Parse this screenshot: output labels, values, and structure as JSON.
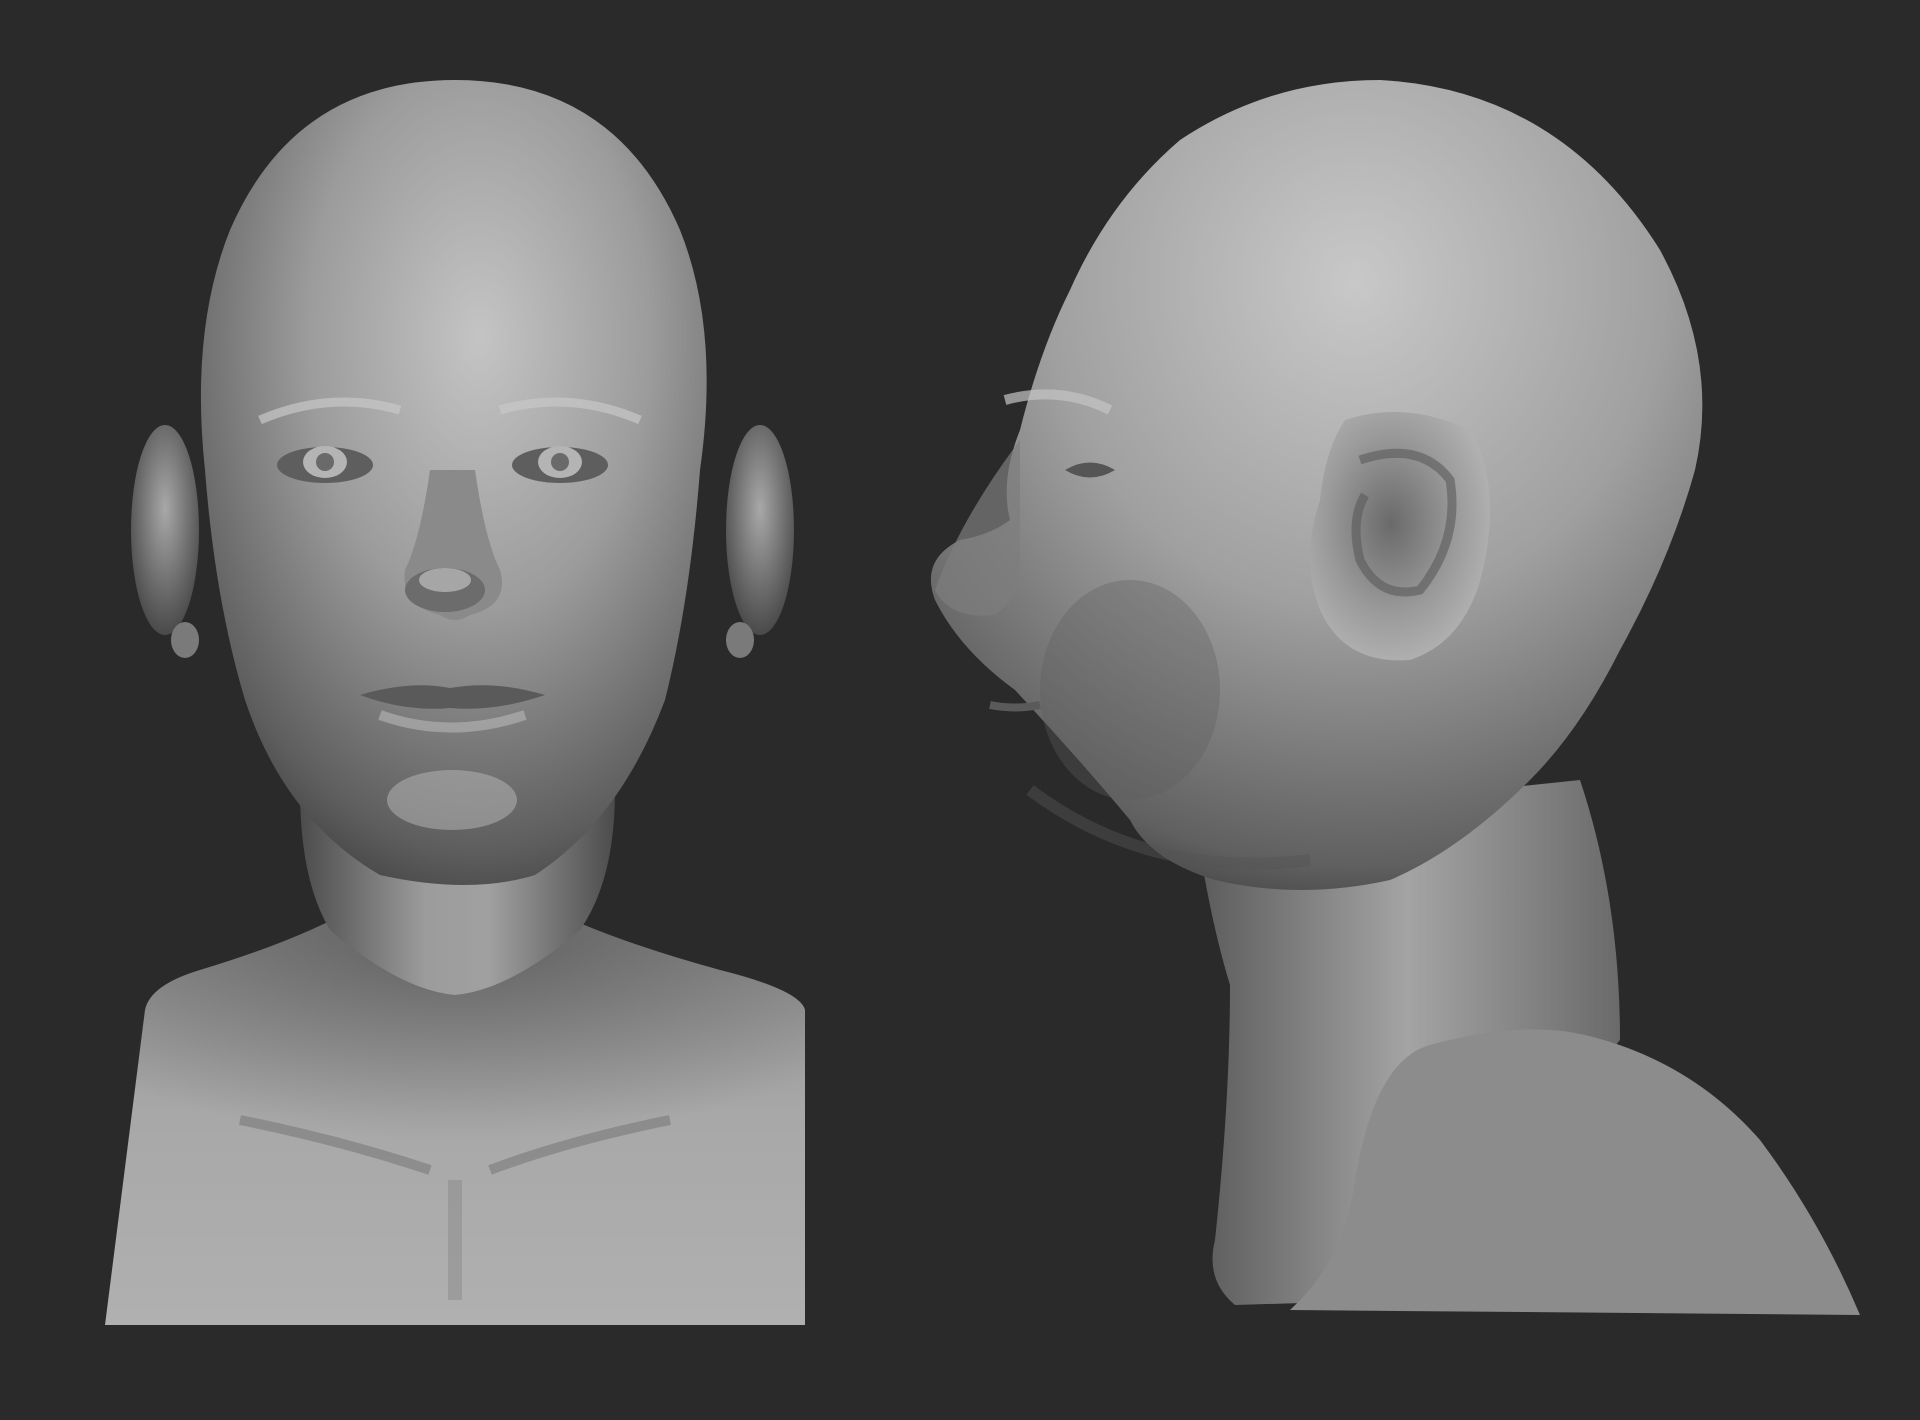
{
  "scene": {
    "background_color": "#2a2a2a",
    "clay_color": "#9a9a9a",
    "cap_color": "#8c8c8c",
    "views": [
      {
        "key": "front",
        "icon": "front-view-bust"
      },
      {
        "key": "side",
        "icon": "profile-view-bust"
      }
    ]
  }
}
